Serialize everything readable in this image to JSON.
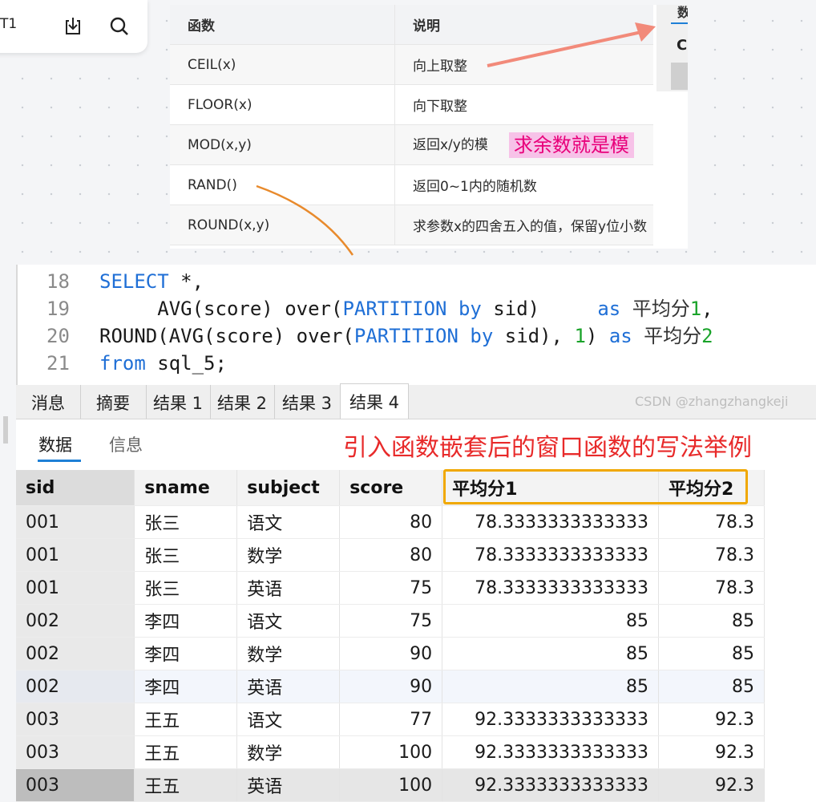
{
  "toolbar": {
    "label": "T1",
    "icons": [
      "download-icon",
      "search-icon"
    ]
  },
  "func_table": {
    "headers": [
      "函数",
      "说明"
    ],
    "rows": [
      {
        "fn": "CEIL(x)",
        "desc": "向上取整",
        "note": ""
      },
      {
        "fn": "FLOOR(x)",
        "desc": "向下取整",
        "note": ""
      },
      {
        "fn": "MOD(x,y)",
        "desc": "返回x/y的模",
        "note": "求余数就是模"
      },
      {
        "fn": "RAND()",
        "desc": "返回0~1内的随机数",
        "note": ""
      },
      {
        "fn": "ROUND(x,y)",
        "desc": "求参数x的四舍五入的值，保留y位小数",
        "note": ""
      }
    ],
    "peek": {
      "head": "数",
      "cell": "C"
    },
    "colors": {
      "pink_note_bg": "#f7c2e8",
      "pink_note_text": "#e8007a",
      "arrow_salmon": "#f28a7a",
      "arrow_orange": "#e88a2c"
    }
  },
  "editor": {
    "lines": [
      {
        "no": "18",
        "tokens": [
          {
            "t": "SELECT",
            "k": "kw"
          },
          {
            "t": " *,",
            "k": ""
          }
        ]
      },
      {
        "no": "19",
        "tokens": [
          {
            "t": "     AVG(score) over(",
            "k": ""
          },
          {
            "t": "PARTITION",
            "k": "kw"
          },
          {
            "t": " ",
            "k": ""
          },
          {
            "t": "by",
            "k": "kw"
          },
          {
            "t": " sid)     ",
            "k": ""
          },
          {
            "t": "as",
            "k": "kw"
          },
          {
            "t": " ",
            "k": ""
          },
          {
            "t": "平均分",
            "k": "cjk"
          },
          {
            "t": "1",
            "k": "num"
          },
          {
            "t": ",",
            "k": ""
          }
        ]
      },
      {
        "no": "20",
        "tokens": [
          {
            "t": "ROUND(AVG(score) over(",
            "k": ""
          },
          {
            "t": "PARTITION",
            "k": "kw"
          },
          {
            "t": " ",
            "k": ""
          },
          {
            "t": "by",
            "k": "kw"
          },
          {
            "t": " sid), ",
            "k": ""
          },
          {
            "t": "1",
            "k": "num"
          },
          {
            "t": ") ",
            "k": ""
          },
          {
            "t": "as",
            "k": "kw"
          },
          {
            "t": " ",
            "k": ""
          },
          {
            "t": "平均分",
            "k": "cjk"
          },
          {
            "t": "2",
            "k": "num"
          }
        ]
      },
      {
        "no": "21",
        "tokens": [
          {
            "t": "from",
            "k": "kw"
          },
          {
            "t": " sql_5;",
            "k": ""
          }
        ]
      }
    ],
    "colors": {
      "keyword": "#1f6fd6",
      "number": "#1aa32a",
      "line_number": "#8a8a8a"
    }
  },
  "result_tabs": [
    "消息",
    "摘要",
    "结果 1",
    "结果 2",
    "结果 3",
    "结果 4"
  ],
  "active_result_tab": "结果 4",
  "sub_tabs": {
    "data": "数据",
    "info": "信息"
  },
  "annotation": "引入函数嵌套后的窗口函数的写法举例",
  "grid": {
    "columns": [
      "sid",
      "sname",
      "subject",
      "score",
      "平均分1",
      "平均分2"
    ],
    "rows": [
      [
        "001",
        "张三",
        "语文",
        "80",
        "78.3333333333333",
        "78.3"
      ],
      [
        "001",
        "张三",
        "数学",
        "80",
        "78.3333333333333",
        "78.3"
      ],
      [
        "001",
        "张三",
        "英语",
        "75",
        "78.3333333333333",
        "78.3"
      ],
      [
        "002",
        "李四",
        "语文",
        "75",
        "85",
        "85"
      ],
      [
        "002",
        "李四",
        "数学",
        "90",
        "85",
        "85"
      ],
      [
        "002",
        "李四",
        "英语",
        "90",
        "85",
        "85"
      ],
      [
        "003",
        "王五",
        "语文",
        "77",
        "92.3333333333333",
        "92.3"
      ],
      [
        "003",
        "王五",
        "数学",
        "100",
        "92.3333333333333",
        "92.3"
      ],
      [
        "003",
        "王五",
        "英语",
        "100",
        "92.3333333333333",
        "92.3"
      ]
    ],
    "highlight_row": 5,
    "selected_row": 8,
    "highlight_color": "#f0a800"
  },
  "watermark": "CSDN @zhangzhangkeji"
}
